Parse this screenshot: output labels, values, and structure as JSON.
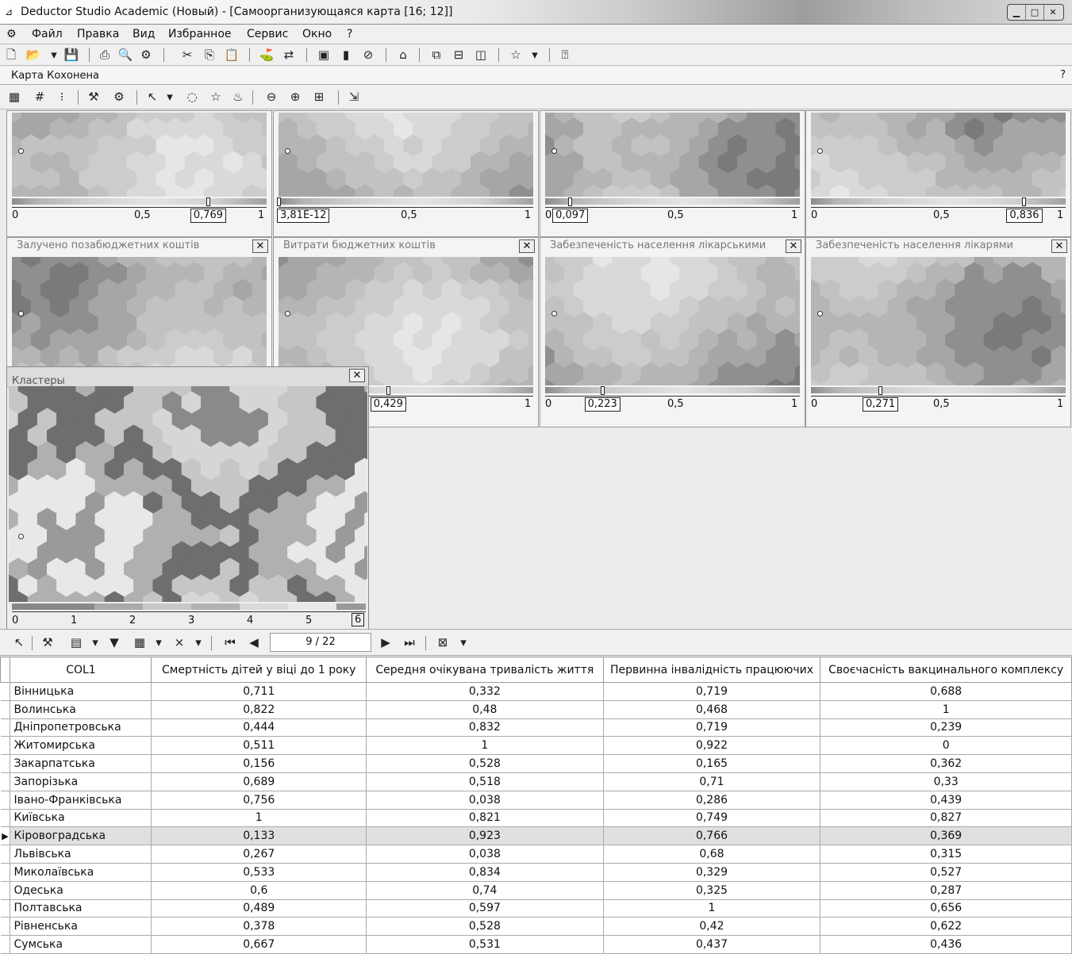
{
  "window": {
    "title": "Deductor Studio Academic (Новый) - [Самоорганизующаяся карта [16; 12]]",
    "controls": [
      "▁",
      "□",
      "✕"
    ]
  },
  "menu": [
    "Файл",
    "Правка",
    "Вид",
    "Избранное",
    "Сервис",
    "Окно",
    "?"
  ],
  "subheader": {
    "label": "Карта Кохонена",
    "help": "?"
  },
  "panels_top": [
    {
      "title": "",
      "ticks": [
        "0",
        "0,5",
        "1"
      ],
      "value": "0,769",
      "marker": 0.769,
      "has_close": false
    },
    {
      "title": "",
      "ticks": [
        "",
        "0,5",
        "1"
      ],
      "value": "3,81E-12",
      "marker": 0.0,
      "has_close": false
    },
    {
      "title": "",
      "ticks": [
        "0",
        "0,5",
        "1"
      ],
      "value": "0,097",
      "marker": 0.097,
      "has_close": false
    },
    {
      "title": "",
      "ticks": [
        "0",
        "0,5",
        "1"
      ],
      "value": "0,836",
      "marker": 0.836,
      "has_close": false
    }
  ],
  "panels_mid": [
    {
      "title": "Залучено позабюджетних коштів",
      "ticks": [
        "0",
        "0,5",
        "1"
      ],
      "value": "",
      "marker": null,
      "has_close": true
    },
    {
      "title": "Витрати бюджетних коштів",
      "ticks": [
        "",
        "5",
        "1"
      ],
      "value": "0,429",
      "marker": 0.429,
      "has_close": true
    },
    {
      "title": "Забезпеченість населення лікарськими",
      "ticks": [
        "0",
        "0,5",
        "1"
      ],
      "value": "0,223",
      "marker": 0.223,
      "has_close": true
    },
    {
      "title": "Забезпеченість населення лікарями",
      "ticks": [
        "0",
        "0,5",
        "1"
      ],
      "value": "0,271",
      "marker": 0.271,
      "has_close": true
    }
  ],
  "clusters": {
    "title": "Кластеры",
    "ticks": [
      "0",
      "1",
      "2",
      "3",
      "4",
      "5",
      "6"
    ]
  },
  "pager": {
    "text": "9 / 22"
  },
  "table": {
    "headers": [
      "COL1",
      "Смертність дітей у віці до 1 року",
      "Середня очікувана тривалість життя",
      "Первинна інвалідність працюючих",
      "Своєчасність вакцинального комплексу"
    ],
    "rows": [
      [
        "Вінницька",
        "0,711",
        "0,332",
        "0,719",
        "0,688"
      ],
      [
        "Волинська",
        "0,822",
        "0,48",
        "0,468",
        "1"
      ],
      [
        "Дніпропетровська",
        "0,444",
        "0,832",
        "0,719",
        "0,239"
      ],
      [
        "Житомирська",
        "0,511",
        "1",
        "0,922",
        "0"
      ],
      [
        "Закарпатська",
        "0,156",
        "0,528",
        "0,165",
        "0,362"
      ],
      [
        "Запорізька",
        "0,689",
        "0,518",
        "0,71",
        "0,33"
      ],
      [
        "Івано-Франківська",
        "0,756",
        "0,038",
        "0,286",
        "0,439"
      ],
      [
        "Київська",
        "1",
        "0,821",
        "0,749",
        "0,827"
      ],
      [
        "Кіровоградська",
        "0,133",
        "0,923",
        "0,766",
        "0,369"
      ],
      [
        "Львівська",
        "0,267",
        "0,038",
        "0,68",
        "0,315"
      ],
      [
        "Миколаївська",
        "0,533",
        "0,834",
        "0,329",
        "0,527"
      ],
      [
        "Одеська",
        "0,6",
        "0,74",
        "0,325",
        "0,287"
      ],
      [
        "Полтавська",
        "0,489",
        "0,597",
        "1",
        "0,656"
      ],
      [
        "Рівненська",
        "0,378",
        "0,528",
        "0,42",
        "0,622"
      ],
      [
        "Сумська",
        "0,667",
        "0,531",
        "0,437",
        "0,436"
      ]
    ],
    "selected_row": 8
  }
}
